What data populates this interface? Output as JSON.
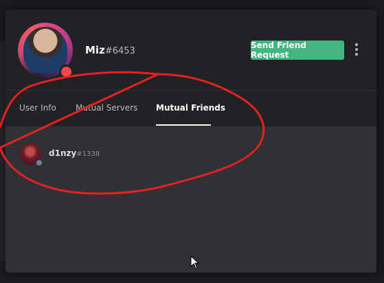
{
  "profile": {
    "username": "Miz",
    "discriminator": "#6453",
    "status_color": "#f04747",
    "send_request_label": "Send Friend Request",
    "more_icon": "more-vertical-icon"
  },
  "tabs": [
    {
      "label": "User Info",
      "active": false
    },
    {
      "label": "Mutual Servers",
      "active": false
    },
    {
      "label": "Mutual Friends",
      "active": true
    }
  ],
  "mutual_friends": [
    {
      "name": "d1nzy",
      "discriminator": "#1338",
      "status_color": "#747f8d"
    }
  ],
  "colors": {
    "accent_green": "#43b581",
    "annotation_red": "#e8211f",
    "panel": "#2f3136",
    "header": "#202225"
  }
}
